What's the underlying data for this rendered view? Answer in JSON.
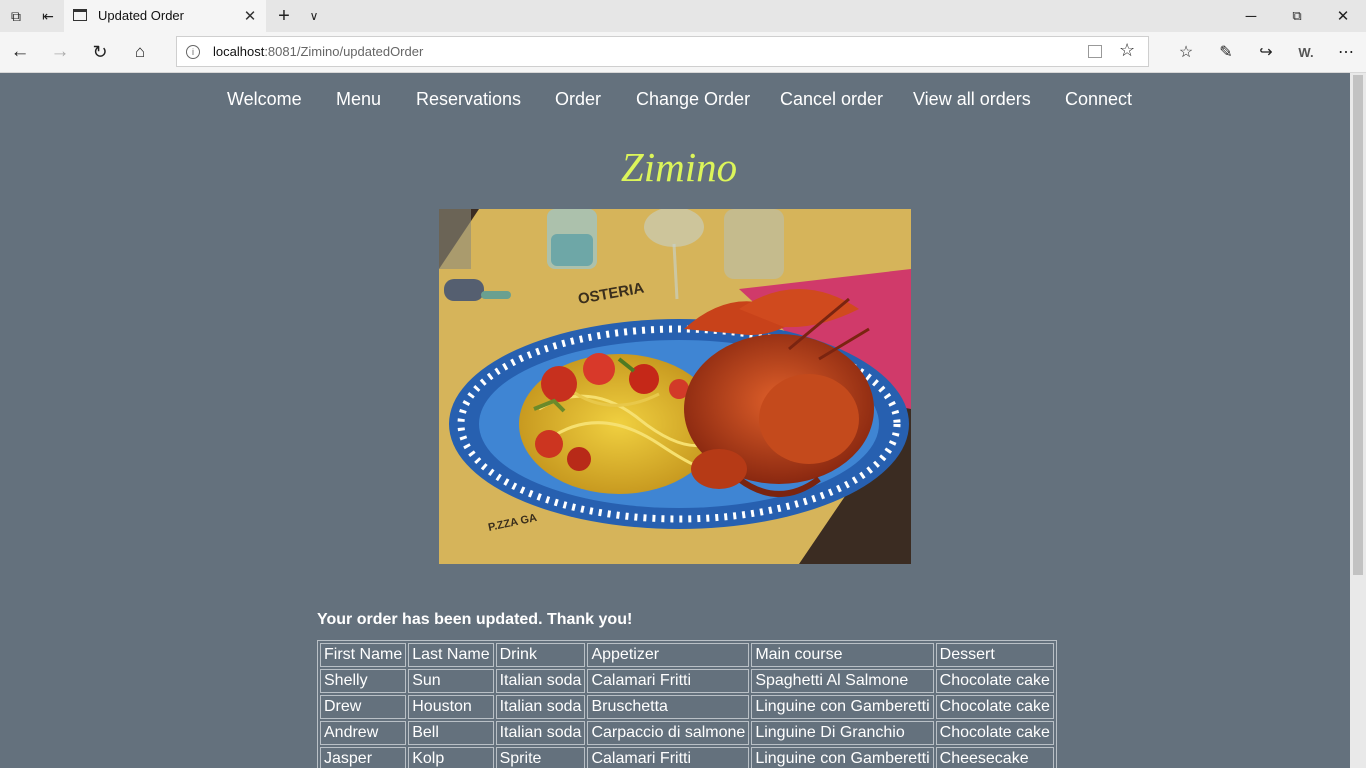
{
  "browser": {
    "tab_title": "Updated Order",
    "url_host": "localhost",
    "url_path": ":8081/Zimino/updatedOrder",
    "icons": {
      "tab_actions": "tab-actions-icon",
      "set_aside": "set-aside-tabs-icon",
      "new_tab": "plus-icon",
      "tab_list": "chevron-down-icon",
      "minimize": "minimize-icon",
      "restore": "restore-icon",
      "close": "close-icon"
    },
    "toolbar_tools": [
      "favorites-icon",
      "pen-icon",
      "share-icon",
      "extension-icon",
      "more-icon"
    ],
    "extension_label": "W."
  },
  "nav": {
    "items": [
      "Welcome",
      "Menu",
      "Reservations",
      "Order",
      "Change Order",
      "Cancel order",
      "View all orders",
      "Connect"
    ]
  },
  "brand": {
    "name": "Zimino",
    "color": "#dcf55a"
  },
  "page": {
    "background": "#64717d",
    "photo_description": "lobster-pasta-photo",
    "message": "Your order has been updated. Thank you!"
  },
  "orders": {
    "headers": [
      "First Name",
      "Last Name",
      "Drink",
      "Appetizer",
      "Main course",
      "Dessert"
    ],
    "rows": [
      [
        "Shelly",
        "Sun",
        "Italian soda",
        "Calamari Fritti",
        "Spaghetti Al Salmone",
        "Chocolate cake"
      ],
      [
        "Drew",
        "Houston",
        "Italian soda",
        "Bruschetta",
        "Linguine con Gamberetti",
        "Chocolate cake"
      ],
      [
        "Andrew",
        "Bell",
        "Italian soda",
        "Carpaccio di salmone",
        "Linguine Di Granchio",
        "Chocolate cake"
      ],
      [
        "Jasper",
        "Kolp",
        "Sprite",
        "Calamari Fritti",
        "Linguine con Gamberetti",
        "Cheesecake"
      ]
    ]
  }
}
